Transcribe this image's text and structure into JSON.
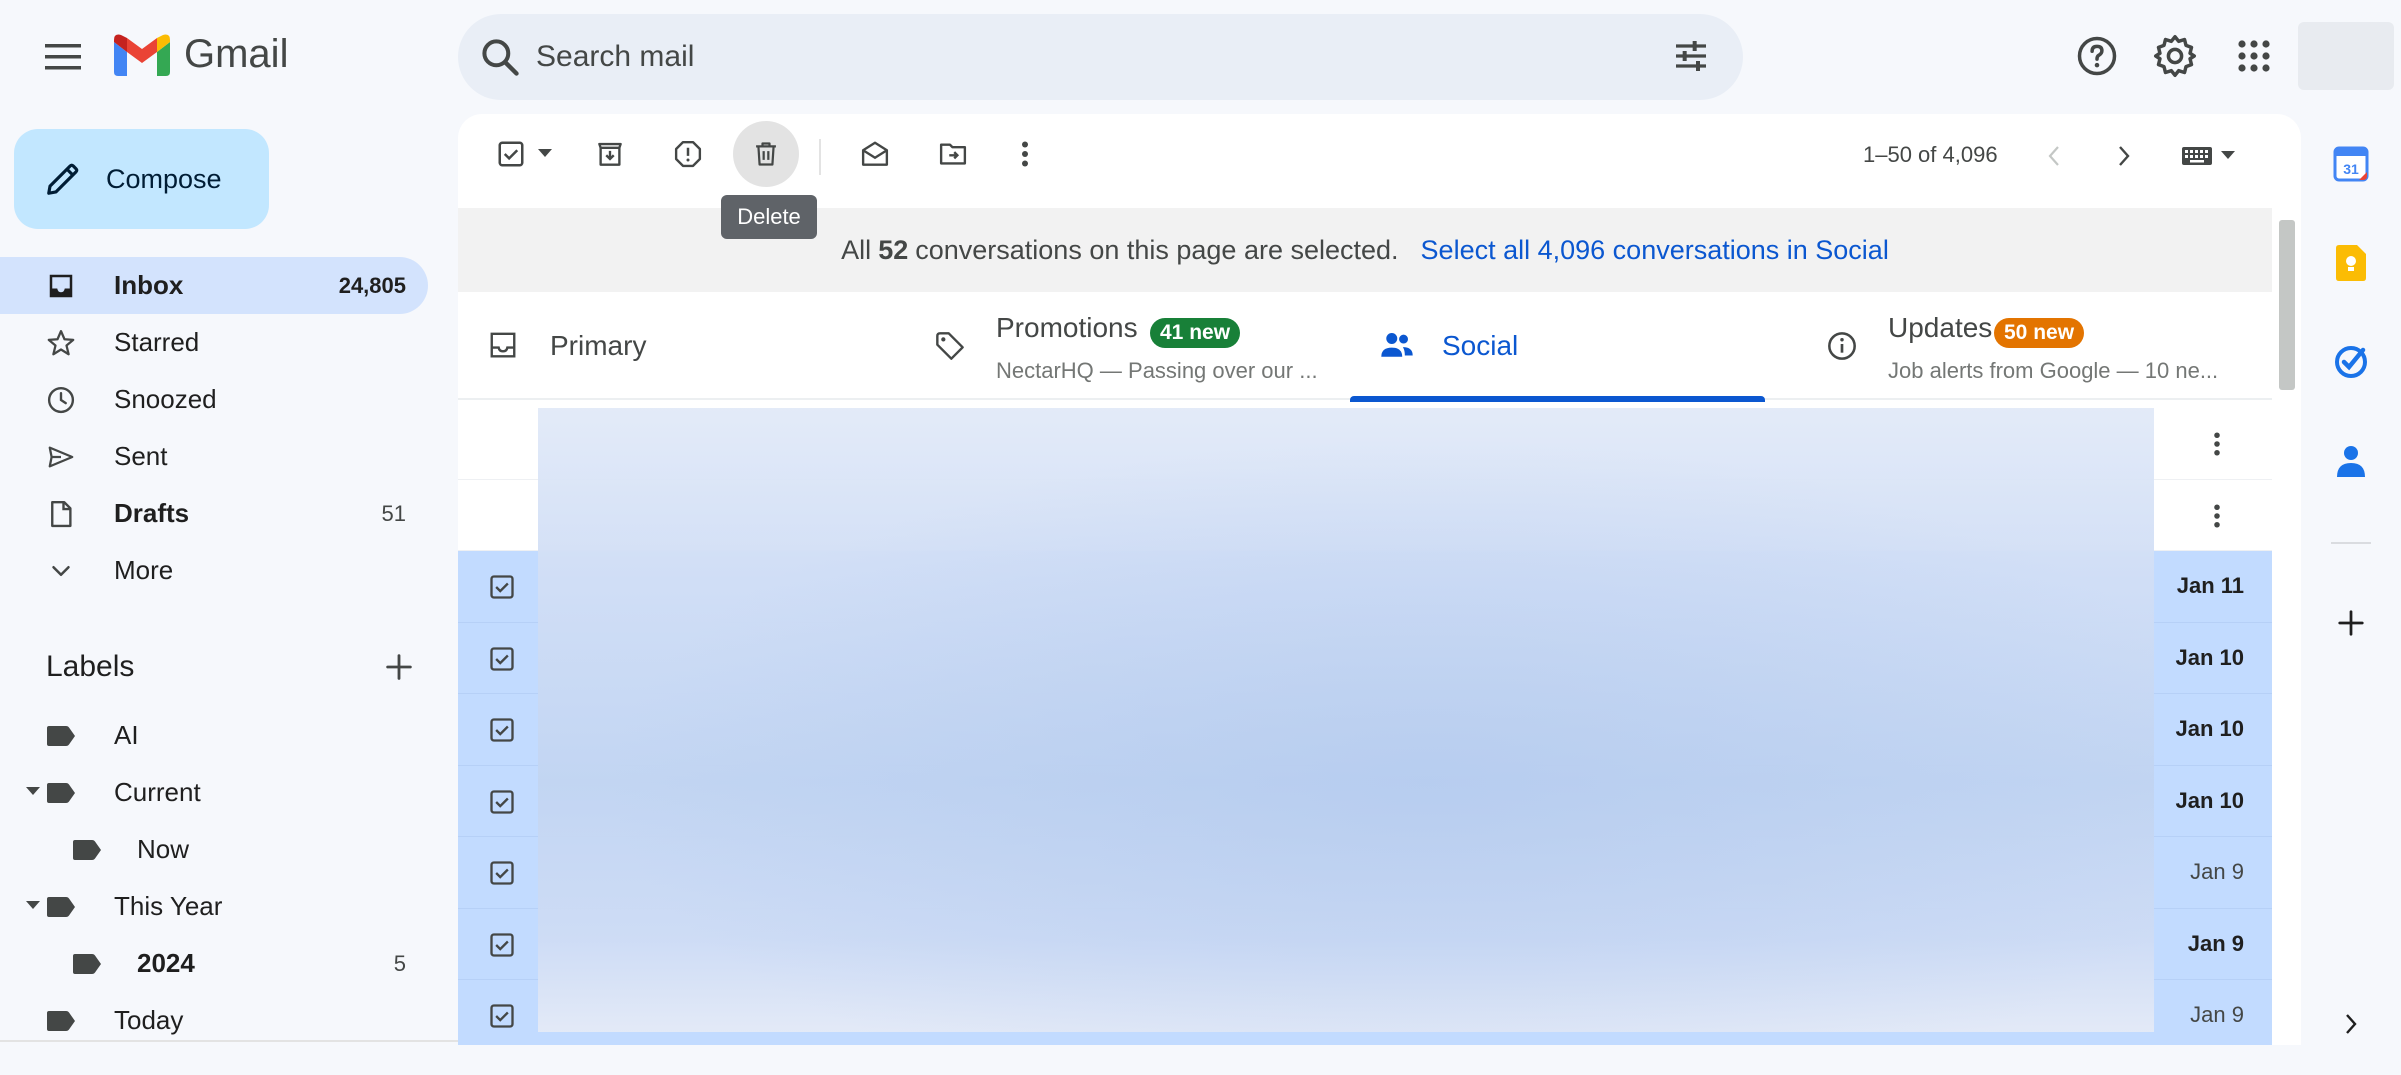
{
  "app": {
    "name": "Gmail"
  },
  "search": {
    "placeholder": "Search mail"
  },
  "compose": {
    "label": "Compose"
  },
  "nav": [
    {
      "label": "Inbox",
      "count": "24,805",
      "icon": "inbox-icon",
      "active": true
    },
    {
      "label": "Starred",
      "count": "",
      "icon": "star-icon"
    },
    {
      "label": "Snoozed",
      "count": "",
      "icon": "clock-icon"
    },
    {
      "label": "Sent",
      "count": "",
      "icon": "send-icon"
    },
    {
      "label": "Drafts",
      "count": "51",
      "icon": "draft-icon",
      "bold": true
    },
    {
      "label": "More",
      "count": "",
      "icon": "chevron-down-icon"
    }
  ],
  "labels": {
    "title": "Labels",
    "items": [
      {
        "name": "AI",
        "count": "",
        "expanded": null,
        "level": 0
      },
      {
        "name": "Current",
        "count": "",
        "expanded": true,
        "level": 0
      },
      {
        "name": "Now",
        "count": "",
        "expanded": null,
        "level": 1
      },
      {
        "name": "This Year",
        "count": "",
        "expanded": true,
        "level": 0
      },
      {
        "name": "2024",
        "count": "5",
        "expanded": null,
        "level": 1,
        "bold": true
      },
      {
        "name": "Today",
        "count": "",
        "expanded": null,
        "level": 0
      }
    ]
  },
  "toolbar": {
    "tooltip": "Delete",
    "pager": "1–50 of 4,096"
  },
  "selection_banner": {
    "prefix": "All",
    "count": "52",
    "middle": "conversations on this page are selected.",
    "link": "Select all 4,096 conversations in Social"
  },
  "tabs": [
    {
      "title": "Primary",
      "badge": "",
      "snippet": "",
      "icon": "inbox-tab-icon"
    },
    {
      "title": "Promotions",
      "badge": "41 new",
      "badge_color": "#188038",
      "snippet": "NectarHQ — Passing over our ...",
      "icon": "tag-icon"
    },
    {
      "title": "Social",
      "badge": "",
      "snippet": "",
      "icon": "people-icon",
      "active": true
    },
    {
      "title": "Updates",
      "badge": "50 new",
      "badge_color": "#e37400",
      "snippet": "Job alerts from Google — 10 ne...",
      "icon": "info-icon"
    }
  ],
  "rows": [
    {
      "date": "",
      "selected": false,
      "bold": false
    },
    {
      "date": "",
      "selected": false,
      "bold": false
    },
    {
      "date": "Jan 11",
      "selected": true,
      "bold": true
    },
    {
      "date": "Jan 10",
      "selected": true,
      "bold": true
    },
    {
      "date": "Jan 10",
      "selected": true,
      "bold": true
    },
    {
      "date": "Jan 10",
      "selected": true,
      "bold": true
    },
    {
      "date": "Jan 9",
      "selected": true,
      "bold": false
    },
    {
      "date": "Jan 9",
      "selected": true,
      "bold": true
    },
    {
      "date": "Jan 9",
      "selected": true,
      "bold": false
    }
  ],
  "colors": {
    "accent": "#0b57d0",
    "compose_bg": "#c2e7ff",
    "active_nav_bg": "#d3e3fd",
    "selected_row_bg": "#c2dbff"
  },
  "side_panel": {
    "icons": [
      "calendar-icon",
      "keep-icon",
      "tasks-icon",
      "contacts-icon",
      "add-addon-icon",
      "expand-panel-icon"
    ],
    "calendar_day": "31"
  }
}
